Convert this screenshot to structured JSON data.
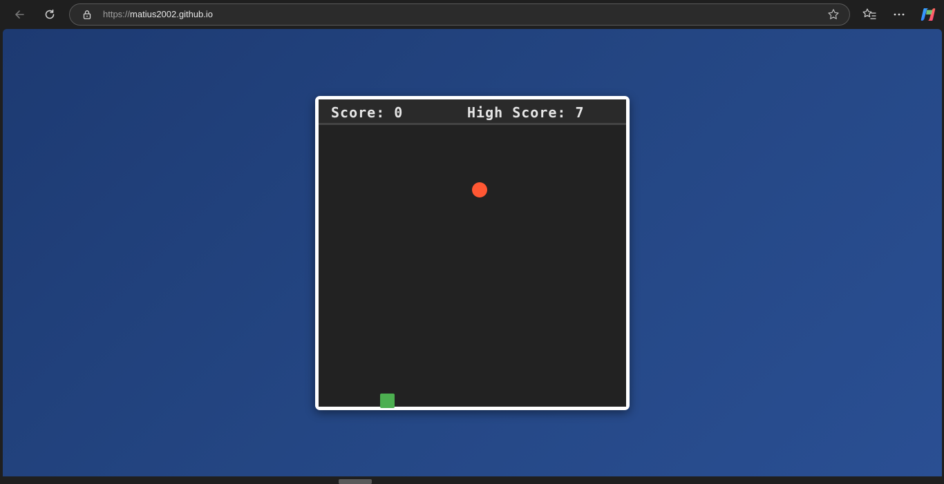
{
  "browser": {
    "url_scheme": "https://",
    "url_host": "matius2002.github.io",
    "icons": {
      "back": "back-arrow-icon",
      "reload": "reload-icon",
      "lock": "lock-icon",
      "favorite": "star-icon",
      "favorites": "favorites-icon",
      "more": "more-icon",
      "copilot": "copilot-icon"
    }
  },
  "game": {
    "score_label": "Score:",
    "score_value": "0",
    "high_score_label": "High Score:",
    "high_score_value": "7",
    "colors": {
      "food": "#ff5733",
      "snake": "#4caf50",
      "board": "#222222",
      "frame": "#ffffff",
      "page_background": "#244683"
    }
  }
}
